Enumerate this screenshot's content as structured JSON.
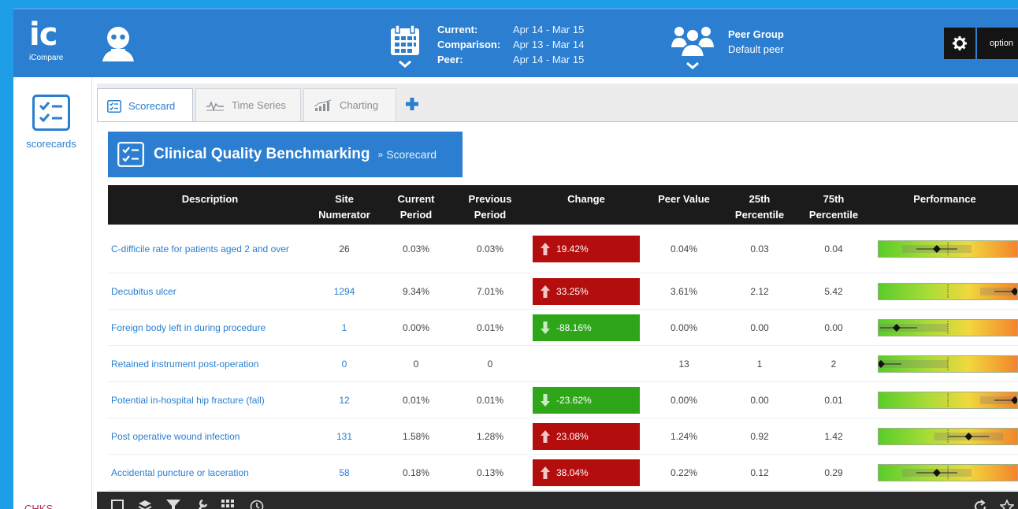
{
  "app": {
    "logo_mark": "ic",
    "logo_name": "iCompare"
  },
  "header": {
    "dates": [
      {
        "key": "Current:",
        "value": "Apr 14 - Mar 15"
      },
      {
        "key": "Comparison:",
        "value": "Apr 13 - Mar 14"
      },
      {
        "key": "Peer:",
        "value": "Apr 14 - Mar 15"
      }
    ],
    "peer_group_title": "Peer Group",
    "peer_group_value": "Default peer",
    "options_label": "option"
  },
  "sidebar": {
    "scorecards_label": "scorecards",
    "bottom_text": "CHKS"
  },
  "tabs": [
    {
      "label": "Scorecard",
      "icon": "checklist-icon",
      "active": true
    },
    {
      "label": "Time Series",
      "icon": "line-chart-icon",
      "active": false
    },
    {
      "label": "Charting",
      "icon": "bar-chart-icon",
      "active": false
    }
  ],
  "breadcrumb": {
    "title": "Clinical Quality Benchmarking",
    "separator": "»",
    "sub": "Scorecard"
  },
  "table": {
    "headers": {
      "description": "Description",
      "site_1": "Site",
      "site_2": "Numerator",
      "current_1": "Current",
      "current_2": "Period",
      "previous_1": "Previous",
      "previous_2": "Period",
      "change": "Change",
      "peer": "Peer Value",
      "p25_1": "25th",
      "p25_2": "Percentile",
      "p75_1": "75th",
      "p75_2": "Percentile",
      "performance": "Performance"
    },
    "rows": [
      {
        "description": "C-difficile rate for patients aged 2 and over",
        "site": "26",
        "current": "0.03%",
        "previous": "0.03%",
        "change": "19.42%",
        "direction": "up",
        "peer": "0.04%",
        "p25": "0.03",
        "p75": "0.04",
        "perf_marker": 0.42
      },
      {
        "description": "Decubitus ulcer",
        "site": "1294",
        "current": "9.34%",
        "previous": "7.01%",
        "change": "33.25%",
        "direction": "up",
        "peer": "3.61%",
        "p25": "2.12",
        "p75": "5.42",
        "perf_marker": 1.0
      },
      {
        "description": "Foreign body left in during procedure",
        "site": "1",
        "current": "0.00%",
        "previous": "0.01%",
        "change": "-88.16%",
        "direction": "down",
        "peer": "0.00%",
        "p25": "0.00",
        "p75": "0.00",
        "perf_marker": 0.13
      },
      {
        "description": "Retained instrument post-operation",
        "site": "0",
        "current": "0",
        "previous": "0",
        "change": "",
        "direction": "none",
        "peer": "13",
        "p25": "1",
        "p75": "2",
        "perf_marker": 0.0
      },
      {
        "description": "Potential in-hospital hip fracture (fall)",
        "site": "12",
        "current": "0.01%",
        "previous": "0.01%",
        "change": "-23.62%",
        "direction": "down",
        "peer": "0.00%",
        "p25": "0.00",
        "p75": "0.01",
        "perf_marker": 1.0
      },
      {
        "description": "Post operative wound infection",
        "site": "131",
        "current": "1.58%",
        "previous": "1.28%",
        "change": "23.08%",
        "direction": "up",
        "peer": "1.24%",
        "p25": "0.92",
        "p75": "1.42",
        "perf_marker": 0.65
      },
      {
        "description": "Accidental puncture or laceration",
        "site": "58",
        "current": "0.18%",
        "previous": "0.13%",
        "change": "38.04%",
        "direction": "up",
        "peer": "0.22%",
        "p25": "0.12",
        "p75": "0.29",
        "perf_marker": 0.42
      }
    ]
  },
  "colors": {
    "brand_blue": "#2c7fd0",
    "increase_red": "#b30d0d",
    "decrease_green": "#2fa61a",
    "header_dark": "#1b1b1b"
  }
}
